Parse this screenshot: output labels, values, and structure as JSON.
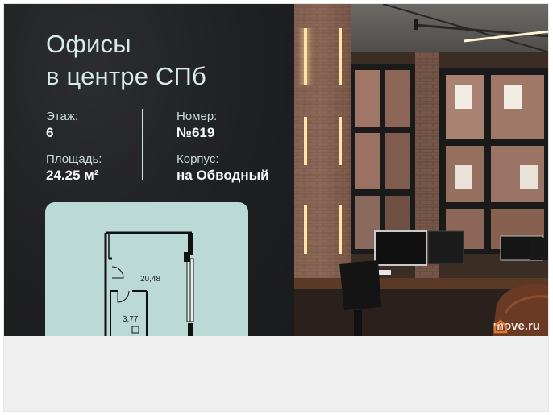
{
  "banner": {
    "title_line1": "Офисы",
    "title_line2": "в центре СПб",
    "floor_label": "Этаж:",
    "floor_value": "6",
    "number_label": "Номер:",
    "number_value": "№619",
    "area_label": "Площадь:",
    "area_value": "24.25 м²",
    "building_label": "Корпус:",
    "building_value": "на Обводный"
  },
  "floor_plan": {
    "room_main_area": "20,48",
    "room_small_area": "3,77"
  },
  "watermark": {
    "brand": "move.ru",
    "brand_color": "#e8762b"
  },
  "colors": {
    "panel_dark": "#1f2022",
    "text_mint": "#d7ece4",
    "plan_card": "#bcdad5"
  }
}
